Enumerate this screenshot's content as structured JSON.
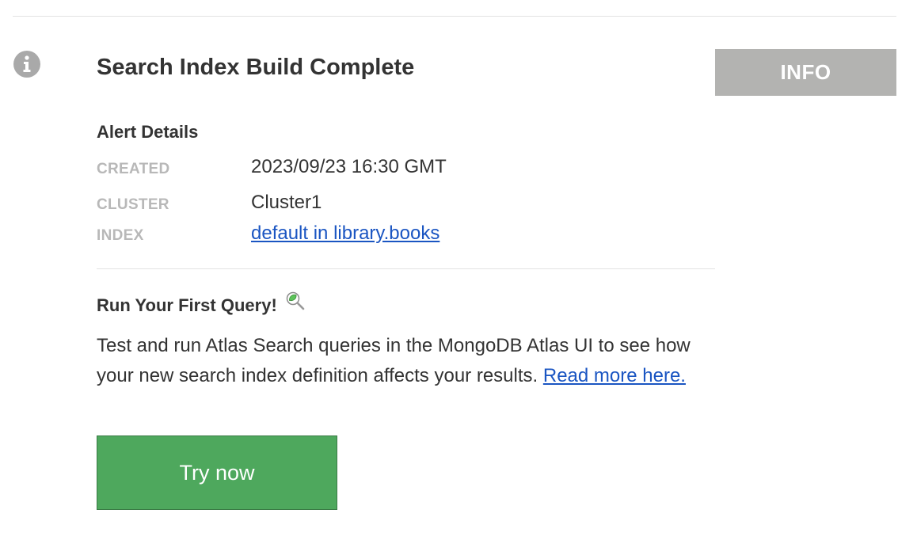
{
  "alert": {
    "title": "Search Index Build Complete",
    "severity": "INFO",
    "icon": "info-icon"
  },
  "details": {
    "heading": "Alert Details",
    "rows": [
      {
        "label": "CREATED",
        "value": "2023/09/23 16:30 GMT"
      },
      {
        "label": "CLUSTER",
        "value": "Cluster1"
      },
      {
        "label": "INDEX",
        "value": "default in library.books",
        "is_link": true
      }
    ]
  },
  "query": {
    "heading": "Run Your First Query!",
    "icon": "magnifier-icon",
    "body": "Test and run Atlas Search queries in the MongoDB Atlas UI to see how your new search index definition affects your results.",
    "link_text": "Read more here.",
    "button_label": "Try now"
  },
  "colors": {
    "badge_background": "#b3b3b1",
    "link": "#1a55c2",
    "button_background": "#4ea85d",
    "label_gray": "#b8b8b8"
  }
}
